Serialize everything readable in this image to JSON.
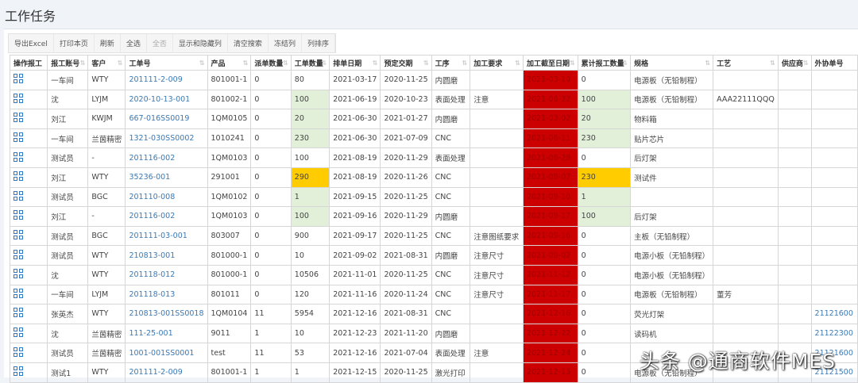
{
  "title": "工作任务",
  "toolbar": [
    "导出Excel",
    "打印本页",
    "刷新",
    "全选",
    "全否",
    "显示和隐藏列",
    "清空搜索",
    "冻结列",
    "列排序"
  ],
  "columns": [
    "操作报工",
    "报工账号",
    "客户",
    "工单号",
    "产品",
    "派单数量",
    "工单数量",
    "排单日期",
    "预定交期",
    "工序",
    "加工要求",
    "加工截至日期",
    "累计报工数量",
    "规格",
    "工艺",
    "供应商",
    "外协单号"
  ],
  "rows": [
    [
      "一车间",
      "WTY",
      "201111-2-009",
      "801001-1",
      "0",
      "80",
      "2021-03-17",
      "2020-11-25",
      "内圆磨",
      "",
      "2021-03-10",
      "0",
      "电源板（无铅制程）",
      "",
      "",
      ""
    ],
    [
      "沈",
      "LYJM",
      "2020-10-13-001",
      "801002-1",
      "0",
      "100",
      "2021-06-19",
      "2020-10-23",
      "表面处理",
      "注意",
      "2021-06-22",
      "100",
      "电源板（无铅制程）",
      "AAA22111QQQ",
      "",
      ""
    ],
    [
      "刘江",
      "KWJM",
      "667-016SS0019",
      "1QM0105",
      "0",
      "20",
      "2021-06-30",
      "2021-01-27",
      "内圆磨",
      "",
      "2021-03-02",
      "20",
      "物料箱",
      "",
      "",
      ""
    ],
    [
      "一车间",
      "兰茵精密",
      "1321-030SS0002",
      "1010241",
      "0",
      "230",
      "2021-06-30",
      "2021-07-09",
      "CNC",
      "",
      "2021-06-11",
      "230",
      "贴片芯片",
      "",
      "",
      ""
    ],
    [
      "测试员",
      "-",
      "201116-002",
      "1QM0103",
      "0",
      "100",
      "2021-08-19",
      "2020-11-29",
      "表面处理",
      "",
      "2021-06-28",
      "0",
      "后灯架",
      "",
      "",
      ""
    ],
    [
      "刘江",
      "WTY",
      "35236-001",
      "291001",
      "0",
      "290",
      "2021-08-19",
      "2020-11-26",
      "CNC",
      "",
      "2021-08-07",
      "230",
      "测试件",
      "",
      "",
      ""
    ],
    [
      "测试员",
      "BGC",
      "201110-008",
      "1QM0102",
      "0",
      "1",
      "2021-09-15",
      "2020-11-25",
      "CNC",
      "",
      "2021-09-10",
      "1",
      "",
      "",
      "",
      ""
    ],
    [
      "刘江",
      "-",
      "201116-002",
      "1QM0103",
      "0",
      "100",
      "2021-09-16",
      "2020-11-29",
      "内圆磨",
      "",
      "2021-09-17",
      "100",
      "后灯架",
      "",
      "",
      ""
    ],
    [
      "测试员",
      "BGC",
      "201111-03-001",
      "803007",
      "0",
      "900",
      "2021-09-17",
      "2020-11-25",
      "CNC",
      "注意图纸要求",
      "2021-09-16",
      "0",
      "主板（无铅制程）",
      "",
      "",
      ""
    ],
    [
      "测试员",
      "WTY",
      "210813-001",
      "801000-1",
      "0",
      "10",
      "2021-09-02",
      "2021-08-31",
      "内圆磨",
      "注意尺寸",
      "2021-09-02",
      "0",
      "电源小板（无铅制程）",
      "",
      "",
      ""
    ],
    [
      "沈",
      "WTY",
      "201118-012",
      "801000-1",
      "0",
      "10506",
      "2021-11-01",
      "2020-11-25",
      "CNC",
      "注意尺寸",
      "2021-11-12",
      "0",
      "电源小板（无铅制程）",
      "",
      "",
      ""
    ],
    [
      "一车间",
      "LYJM",
      "201118-013",
      "801011",
      "0",
      "120",
      "2021-11-16",
      "2020-11-24",
      "CNC",
      "注意尺寸",
      "2021-11-17",
      "0",
      "电源板（无铅制程）",
      "董芳",
      "",
      ""
    ],
    [
      "张英杰",
      "WTY",
      "210813-001SS0018",
      "1QM0104",
      "11",
      "5954",
      "2021-12-16",
      "2021-08-31",
      "CNC",
      "",
      "2021-12-16",
      "0",
      "荧光灯架",
      "",
      "",
      "21121600"
    ],
    [
      "沈",
      "兰茵精密",
      "111-25-001",
      "9011",
      "1",
      "10",
      "2021-12-23",
      "2021-11-20",
      "内圆磨",
      "",
      "2021-12-22",
      "0",
      "读码机",
      "",
      "",
      "21122300"
    ],
    [
      "测试员",
      "兰茵精密",
      "1001-001SS0001",
      "test",
      "11",
      "53",
      "2021-12-16",
      "2021-07-04",
      "表面处理",
      "注意",
      "2021-12-24",
      "0",
      "",
      "",
      "",
      "21121600"
    ],
    [
      "测试1",
      "WTY",
      "201111-2-009",
      "801001-1",
      "1",
      "1",
      "2021-12-15",
      "2020-11-25",
      "激光打印",
      "",
      "2021-12-15",
      "0",
      "电源板（无铅制程）",
      "",
      "",
      "21121500"
    ]
  ],
  "highlights": {
    "green": [
      1,
      2,
      3,
      6,
      7
    ],
    "yellow": [
      5
    ]
  },
  "watermark": "头条 @通商软件MES"
}
